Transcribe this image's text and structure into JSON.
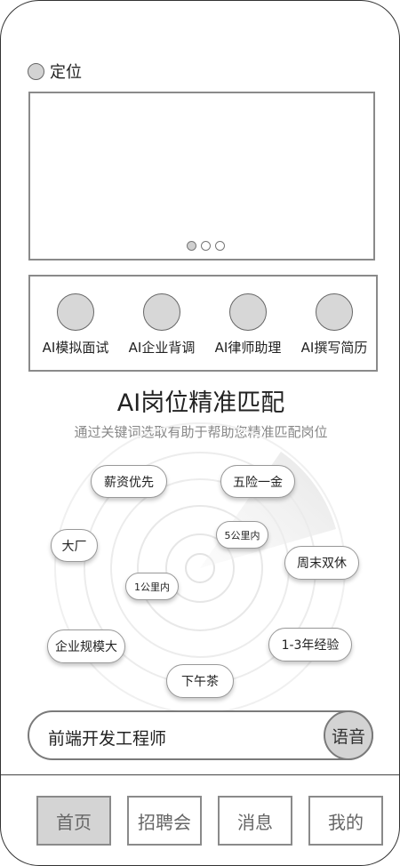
{
  "location": {
    "label": "定位"
  },
  "banner": {
    "pages": 3,
    "active_page": 1
  },
  "features": [
    {
      "label": "AI模拟面试"
    },
    {
      "label": "AI企业背调"
    },
    {
      "label": "AI律师助理"
    },
    {
      "label": "AI撰写简历"
    }
  ],
  "match": {
    "title": "AI岗位精准匹配",
    "subtitle": "通过关键词选取有助于帮助您精准匹配岗位",
    "tags": [
      "薪资优先",
      "五险一金",
      "大厂",
      "5公里内",
      "周末双休",
      "1公里内",
      "企业规模大",
      "1-3年经验",
      "下午茶"
    ]
  },
  "search": {
    "query": "前端开发工程师",
    "voice_label": "语音"
  },
  "tabs": [
    {
      "label": "首页",
      "active": true
    },
    {
      "label": "招聘会",
      "active": false
    },
    {
      "label": "消息",
      "active": false
    },
    {
      "label": "我的",
      "active": false
    }
  ]
}
